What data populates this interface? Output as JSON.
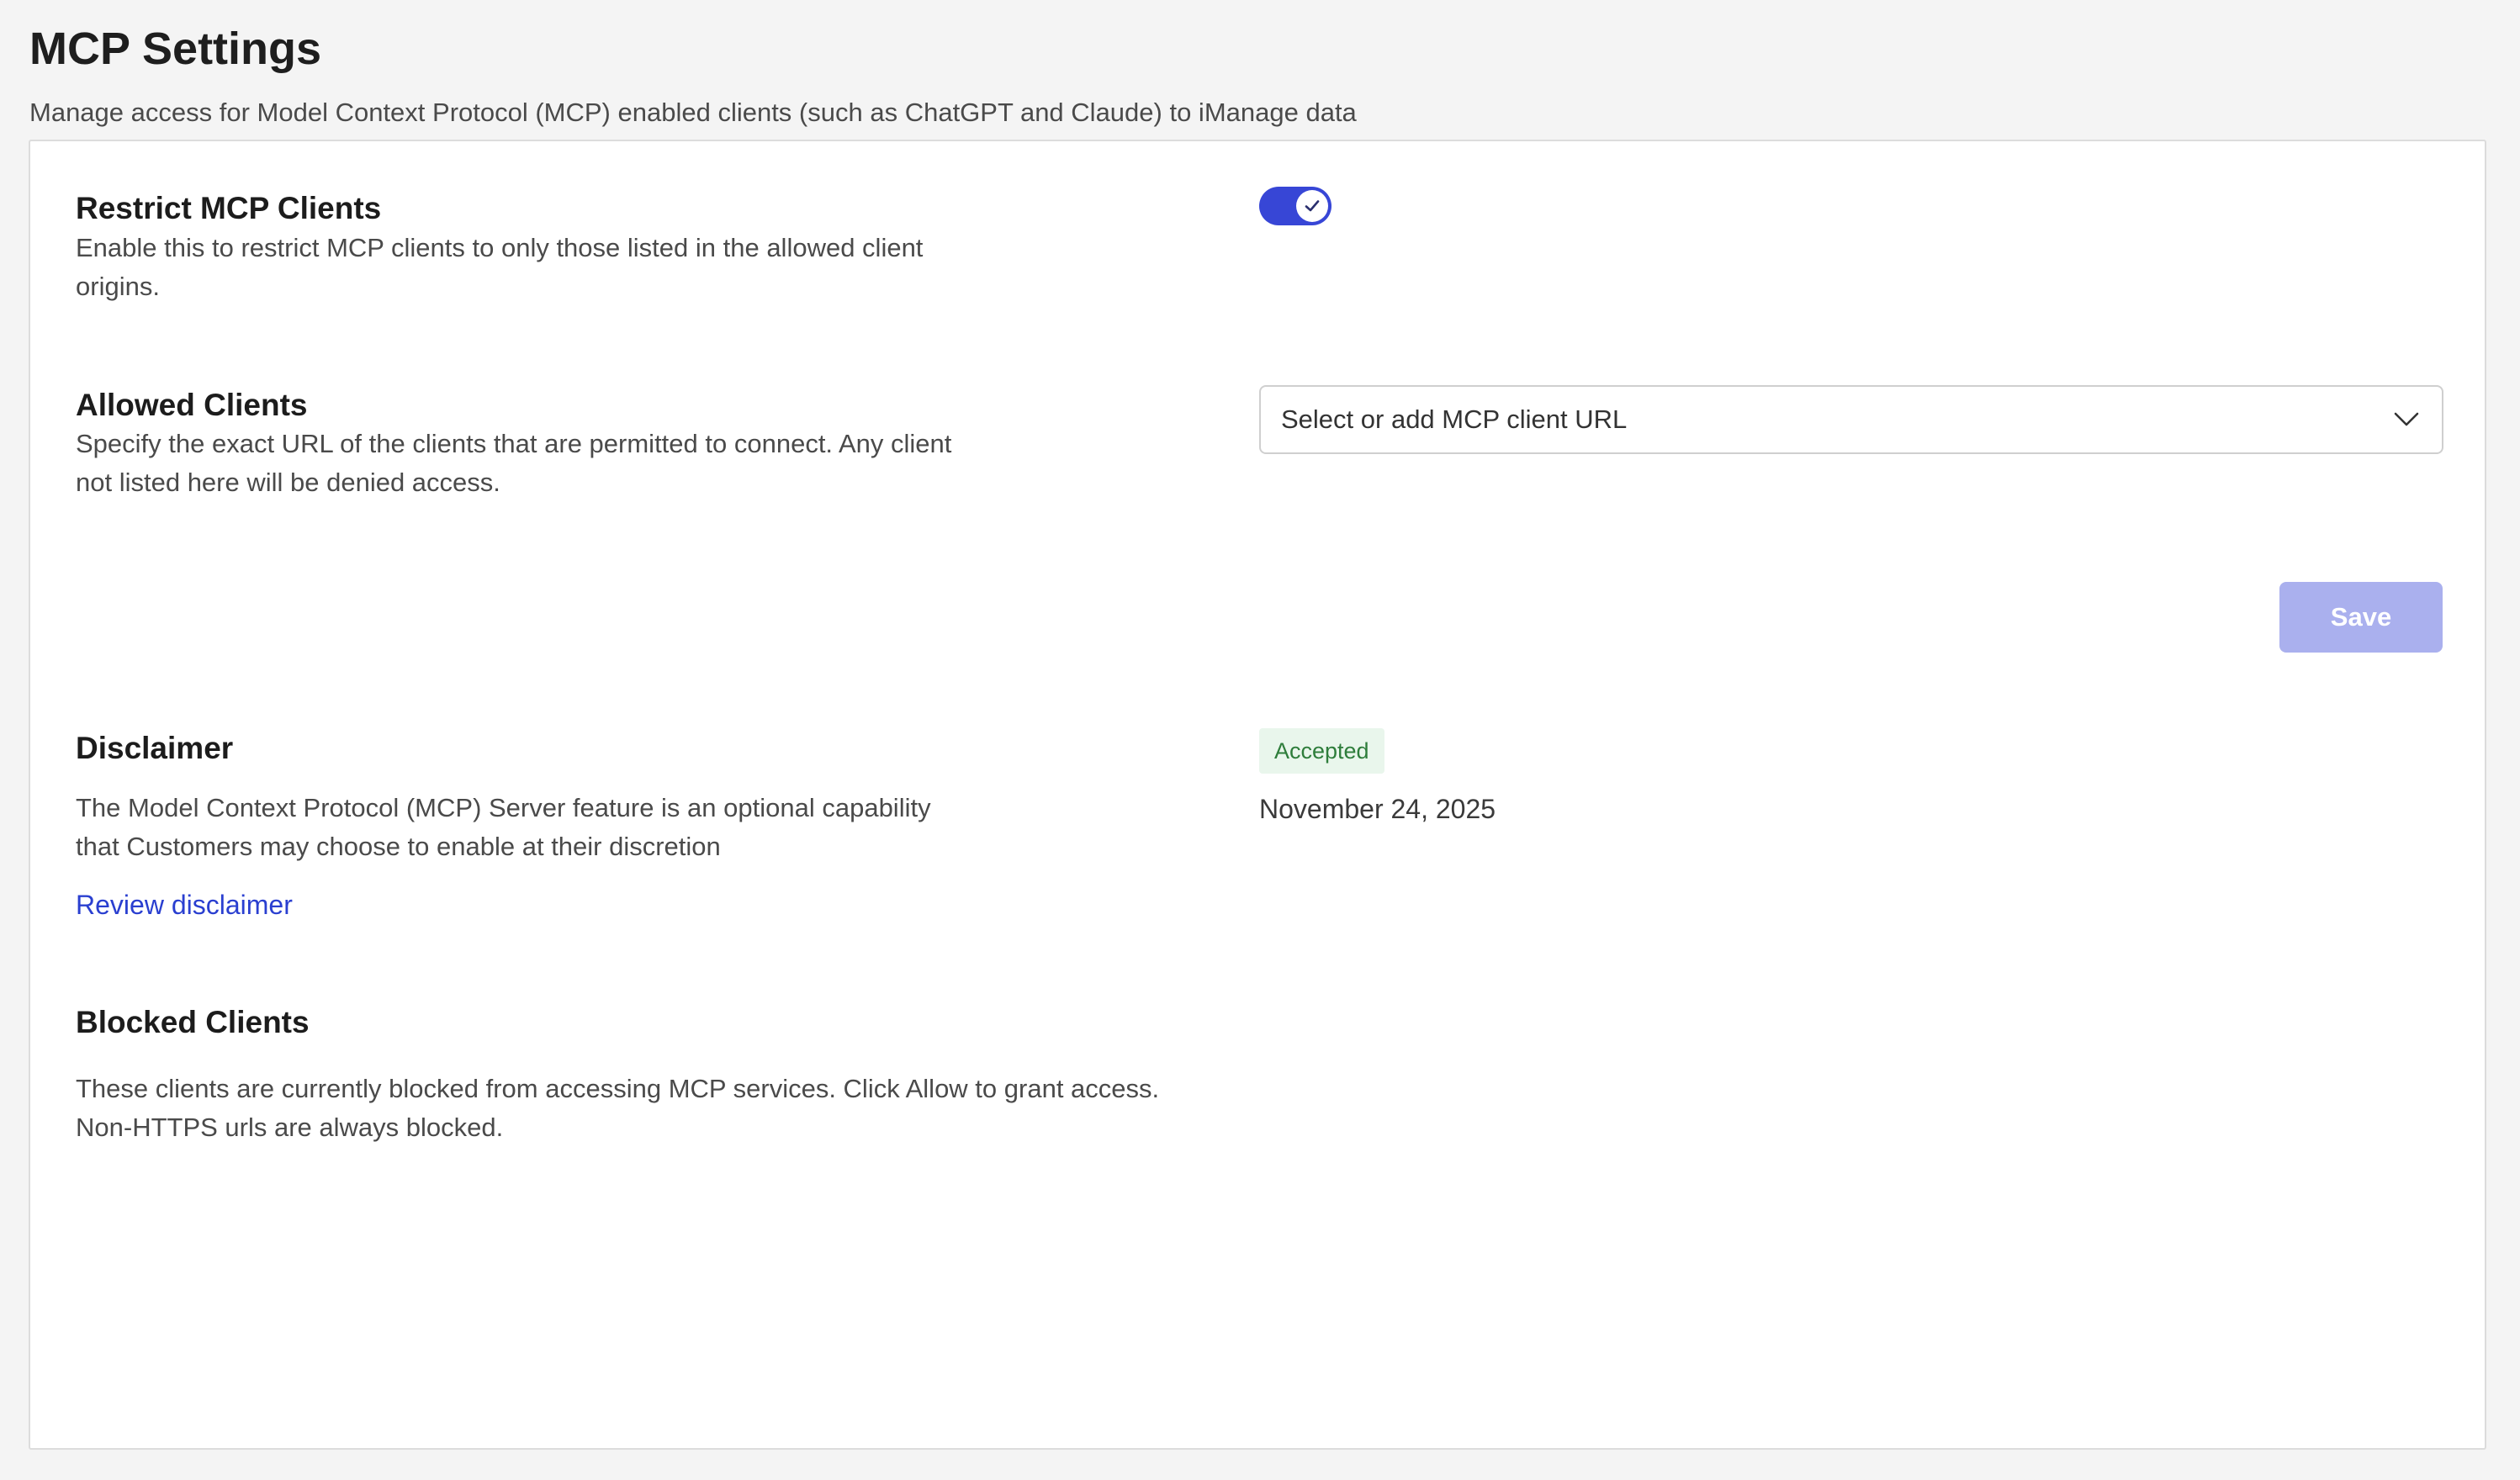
{
  "header": {
    "title": "MCP Settings",
    "subtitle": "Manage access for Model Context Protocol (MCP) enabled clients (such as ChatGPT and Claude) to iManage data"
  },
  "restrict": {
    "title": "Restrict MCP Clients",
    "description_line1": "Enable this to restrict MCP clients to only those listed in the allowed client",
    "description_line2": "origins.",
    "toggle_on": true,
    "toggle_icon": "checkmark-icon"
  },
  "allowed": {
    "title": "Allowed Clients",
    "description_line1": "Specify the exact URL of the clients that are permitted to connect. Any client",
    "description_line2": "not listed here will be denied access.",
    "select_placeholder": "Select or add MCP client URL",
    "select_icon": "chevron-down-icon"
  },
  "save": {
    "label": "Save"
  },
  "disclaimer": {
    "title": "Disclaimer",
    "description_line1": "The Model Context Protocol (MCP) Server feature is an optional capability",
    "description_line2": "that Customers may choose to enable at their discretion",
    "link_label": "Review disclaimer",
    "status": "Accepted",
    "date": "November 24, 2025"
  },
  "blocked": {
    "title": "Blocked Clients",
    "description_line1": "These clients are currently blocked from accessing MCP services. Click Allow to grant access.",
    "description_line2": "Non-HTTPS urls are always blocked."
  },
  "colors": {
    "accent": "#3746d6",
    "save_disabled": "#aab0ee",
    "link": "#2a3fd0",
    "badge_bg": "#e9f6ec",
    "badge_text": "#2e7d3b",
    "page_bg": "#f4f4f4"
  }
}
